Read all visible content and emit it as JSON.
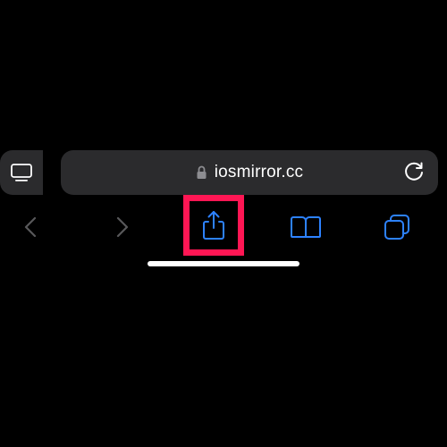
{
  "urlbar": {
    "domain": "iosmirror.cc"
  },
  "icons": {
    "reader": "reader-icon",
    "lock": "lock-icon",
    "reload": "reload-icon",
    "back": "back-icon",
    "forward": "forward-icon",
    "share": "share-icon",
    "bookmarks": "bookmarks-icon",
    "tabs": "tabs-icon"
  },
  "colors": {
    "accent": "#2d82ff",
    "dim": "#58585a",
    "highlight": "#ff1654",
    "text": "#ffffff"
  }
}
